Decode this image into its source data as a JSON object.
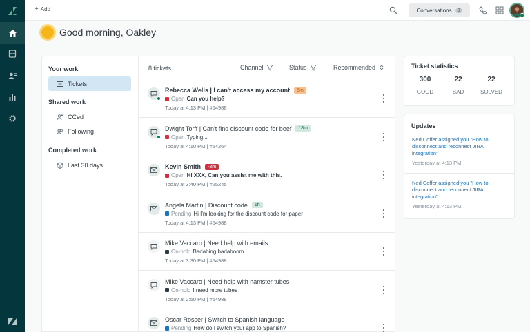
{
  "topbar": {
    "add_label": "Add",
    "conversations_label": "Conversations",
    "conversations_count": "0"
  },
  "greeting": "Good morning, Oakley",
  "sidebar": {
    "your_work": "Your work",
    "tickets": "Tickets",
    "shared_work": "Shared work",
    "cced": "CCed",
    "following": "Following",
    "completed_work": "Completed work",
    "last_30_days": "Last 30 days"
  },
  "ticket_list": {
    "count_label": "8 tickets",
    "channel_filter": "Channel",
    "status_filter": "Status",
    "sort_label": "Recommended",
    "tickets": [
      {
        "title": "Rebecca Wells | I can't access my account",
        "tag": "5m",
        "tag_bg": "#f8c08a",
        "tag_fg": "#ad5e18",
        "status": "Open",
        "status_color": "#cc3340",
        "snippet": "Can you help?",
        "meta": "Today at 4:13 PM | #54988",
        "icon": "chat-icon",
        "online": true,
        "bold": true
      },
      {
        "title": "Dwight Torff | Can't find discount code for beef",
        "tag": "18m",
        "tag_bg": "#d1e8df",
        "tag_fg": "#186146",
        "status": "Open",
        "status_color": "#cc3340",
        "snippet": "Typing...",
        "meta": "Today at 4:10 PM | #54264",
        "icon": "chat-icon",
        "online": true,
        "bold": false
      },
      {
        "title": "Kevin Smith",
        "tag": "-3m",
        "tag_bg": "#cc3340",
        "tag_fg": "#ffffff",
        "status": "Open",
        "status_color": "#cc3340",
        "snippet": "Hi XXX, Can you assist me with this.",
        "meta": "Today at 3:40 PM | #25245",
        "icon": "email-icon",
        "online": false,
        "bold": true
      },
      {
        "title": "Angela Martin | Discount code",
        "tag": "1h",
        "tag_bg": "#d1e8df",
        "tag_fg": "#186146",
        "status": "Pending",
        "status_color": "#1f73b7",
        "snippet": "Hi I'm looking for the discount code for paper",
        "meta": "Today at 4:13 PM | #54988",
        "icon": "email-icon",
        "online": false,
        "bold": false
      },
      {
        "title": "Mike Vaccaro | Need help with emails",
        "tag": "",
        "tag_bg": "",
        "tag_fg": "",
        "status": "On-hold",
        "status_color": "#2f3941",
        "snippet": "Badabing badaboom",
        "meta": "Today at 3:30 PM | #54988",
        "icon": "chat-icon",
        "online": false,
        "bold": false
      },
      {
        "title": "Mike Vaccaro | Need help with hamster tubes",
        "tag": "",
        "tag_bg": "",
        "tag_fg": "",
        "status": "On-hold",
        "status_color": "#2f3941",
        "snippet": "I need more tubes",
        "meta": "Today at 2:50 PM | #54988",
        "icon": "chat-icon",
        "online": false,
        "bold": false
      },
      {
        "title": "Oscar Rosser | Switch to Spanish language",
        "tag": "",
        "tag_bg": "",
        "tag_fg": "",
        "status": "Pending",
        "status_color": "#1f73b7",
        "snippet": "How do I switch your app to Spanish?",
        "meta": "",
        "icon": "email-icon",
        "online": false,
        "bold": false
      }
    ]
  },
  "stats": {
    "title": "Ticket statistics",
    "good_value": "300",
    "good_label": "GOOD",
    "bad_value": "22",
    "bad_label": "BAD",
    "solved_value": "22",
    "solved_label": "SOLVED"
  },
  "updates": {
    "title": "Updates",
    "items": [
      {
        "text": "Ned Coffer assigned you \"How to disconnect and reconnect JIRA integration\"",
        "time": "Yesterday at 4:13 PM"
      },
      {
        "text": "Ned Coffer assigned you \"How to disconnect and reconnect JIRA integration\"",
        "time": "Yesterday at 4:13 PM"
      }
    ]
  }
}
